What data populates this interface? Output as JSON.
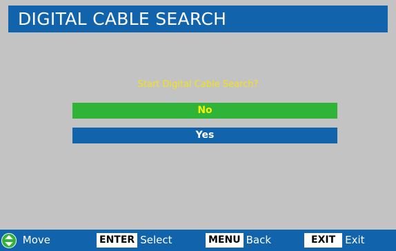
{
  "title": "DIGITAL CABLE SEARCH",
  "prompt": "Start Digital Cable Search?",
  "options": [
    {
      "label": "No",
      "selected": true
    },
    {
      "label": "Yes",
      "selected": false
    }
  ],
  "footer": {
    "move": {
      "icon": "up-down-arrows-icon",
      "label": "Move"
    },
    "enter": {
      "key": "ENTER",
      "label": "Select"
    },
    "menu": {
      "key": "MENU",
      "label": "Back"
    },
    "exit": {
      "key": "EXIT",
      "label": "Exit"
    }
  },
  "colors": {
    "header_blue": "#1163ab",
    "background_gray": "#c3c3c3",
    "selected_green": "#2fb437",
    "prompt_yellow": "#f4e21a"
  }
}
